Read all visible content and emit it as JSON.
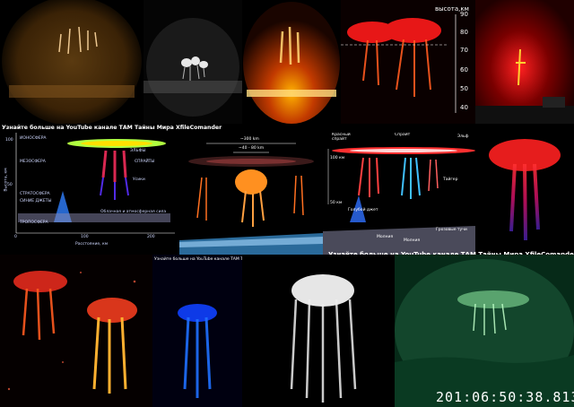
{
  "banners": {
    "left": "Узнайте больше на YouTube канале ТАМ Тайны Мира XfileComander",
    "right": "Узнайте больше на YouTube канале ТАМ Тайны Мира XfileComander",
    "small": "Узнайте больше на YouTube канале ТАМ Тайны Мира XfileComander"
  },
  "altitude_scale": {
    "title": "высота,км",
    "ticks": [
      "90",
      "80",
      "70",
      "60",
      "50",
      "40"
    ]
  },
  "diagram_left": {
    "layers": [
      "ИОНОСФЕРА",
      "МЕЗОСФЕРА",
      "СТРАТОСФЕРА",
      "СИНИЕ ДЖЕТЫ",
      "ТРОПОСФЕРА"
    ],
    "labels": [
      "ЭЛЬФЫ",
      "СПРАЙТЫ",
      "Усики",
      "Облачная и атмосферная сила"
    ],
    "y_ticks": [
      "100",
      "50"
    ],
    "x_ticks": [
      "0",
      "100",
      "200"
    ],
    "ylabel": "Высота, км",
    "xlabel": "Расстояние, км"
  },
  "diagram_center": {
    "dims": [
      "~300 km",
      "~40 - 80 km"
    ]
  },
  "diagram_right": {
    "labels": [
      "Красный спрайт",
      "Спрайт",
      "Эльф",
      "Тайгер",
      "Голубой джет",
      "Молния",
      "Молния",
      "Грозовые тучи"
    ],
    "alt_labels": [
      "100 км",
      "50 км"
    ]
  },
  "timestamp": "201:06:50:38.813"
}
